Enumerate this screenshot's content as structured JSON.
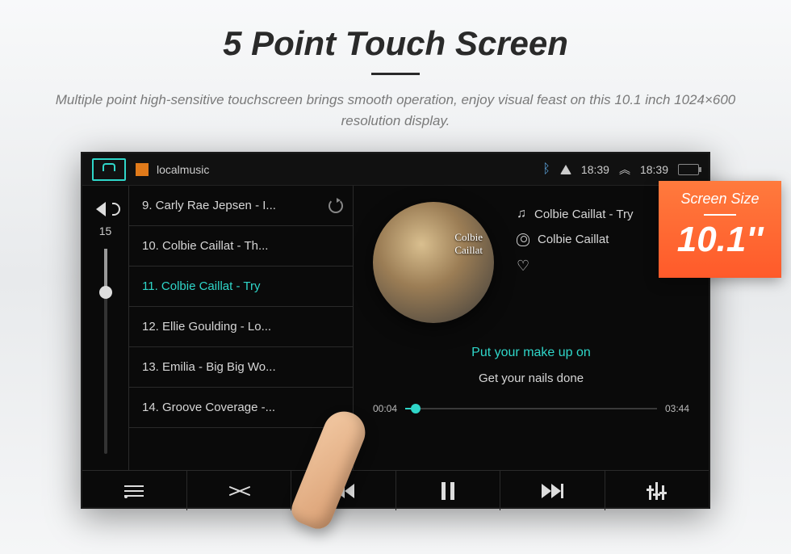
{
  "hero": {
    "title": "5 Point Touch Screen",
    "subtitle": "Multiple point high-sensitive touchscreen brings smooth operation, enjoy visual feast on this 10.1 inch 1024×600 resolution display."
  },
  "status_bar": {
    "app_title": "localmusic",
    "time_primary": "18:39",
    "time_secondary": "18:39"
  },
  "volume": {
    "level": "15"
  },
  "playlist": [
    {
      "label": "9. Carly Rae Jepsen - I...",
      "active": false,
      "loop": true
    },
    {
      "label": "10. Colbie Caillat - Th...",
      "active": false,
      "loop": false
    },
    {
      "label": "11. Colbie Caillat - Try",
      "active": true,
      "loop": false
    },
    {
      "label": "12. Ellie Goulding - Lo...",
      "active": false,
      "loop": false
    },
    {
      "label": "13. Emilia - Big Big Wo...",
      "active": false,
      "loop": false
    },
    {
      "label": "14. Groove Coverage -...",
      "active": false,
      "loop": false
    }
  ],
  "now_playing": {
    "album_line1": "Colbie",
    "album_line2": "Caillat",
    "track_title": "Colbie Caillat - Try",
    "artist": "Colbie Caillat",
    "lyric_active": "Put your make up on",
    "lyric_next": "Get your nails done",
    "elapsed": "00:04",
    "duration": "03:44"
  },
  "size_badge": {
    "title": "Screen Size",
    "value": "10.1''"
  }
}
